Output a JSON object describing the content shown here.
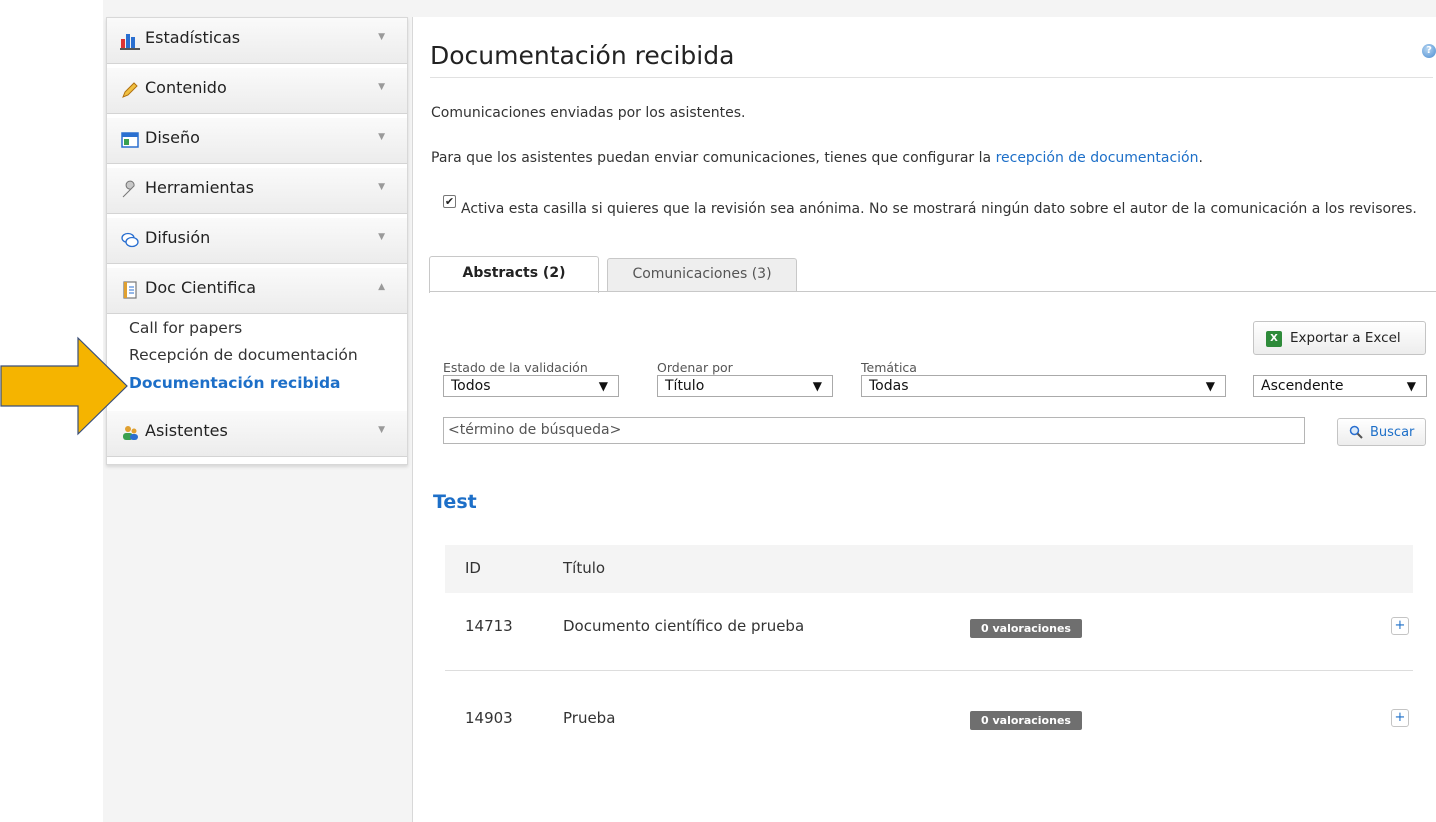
{
  "sidebar": {
    "items": [
      {
        "label": "Estadísticas",
        "icon": "bar-chart-icon"
      },
      {
        "label": "Contenido",
        "icon": "pencil-icon"
      },
      {
        "label": "Diseño",
        "icon": "layout-icon"
      },
      {
        "label": "Herramientas",
        "icon": "wrench-icon"
      },
      {
        "label": "Difusión",
        "icon": "speech-bubbles-icon"
      },
      {
        "label": "Doc Cientifica",
        "icon": "document-icon",
        "expanded": true
      },
      {
        "label": "Asistentes",
        "icon": "users-icon"
      }
    ],
    "doc_submenu": [
      "Call for papers",
      "Recepción de documentación",
      "Documentación recibida"
    ],
    "active_submenu": "Documentación recibida"
  },
  "main": {
    "title": "Documentación recibida",
    "intro": "Comunicaciones enviadas por los asistentes.",
    "config_text": "Para que los asistentes puedan enviar comunicaciones, tienes que configurar la",
    "config_link": "recepción de documentación",
    "config_end": ".",
    "anon_checked": true,
    "anon_text": "Activa esta casilla si quieres que la revisión sea anónima. No se mostrará ningún dato sobre el autor de la comunicación a los revisores.",
    "tabs": [
      {
        "label": "Abstracts (2)",
        "active": true
      },
      {
        "label": "Comunicaciones (3)",
        "active": false
      }
    ],
    "export_label": "Exportar a Excel",
    "filters": {
      "estado": {
        "label": "Estado de la validación",
        "value": "Todos"
      },
      "ordenar": {
        "label": "Ordenar por",
        "value": "Título"
      },
      "tematica": {
        "label": "Temática",
        "value": "Todas"
      },
      "orden": {
        "value": "Ascendente"
      }
    },
    "search": {
      "placeholder": "<término de búsqueda>",
      "button": "Buscar"
    },
    "group": "Test",
    "table": {
      "headers": [
        "ID",
        "Título"
      ],
      "rows": [
        {
          "id": "14713",
          "title": "Documento científico de prueba",
          "badge": "0 valoraciones"
        },
        {
          "id": "14903",
          "title": "Prueba",
          "badge": "0 valoraciones"
        }
      ]
    }
  },
  "colors": {
    "accent": "#1d6fc8",
    "arrow": "#f5b400",
    "badge": "#6f6f6f"
  }
}
